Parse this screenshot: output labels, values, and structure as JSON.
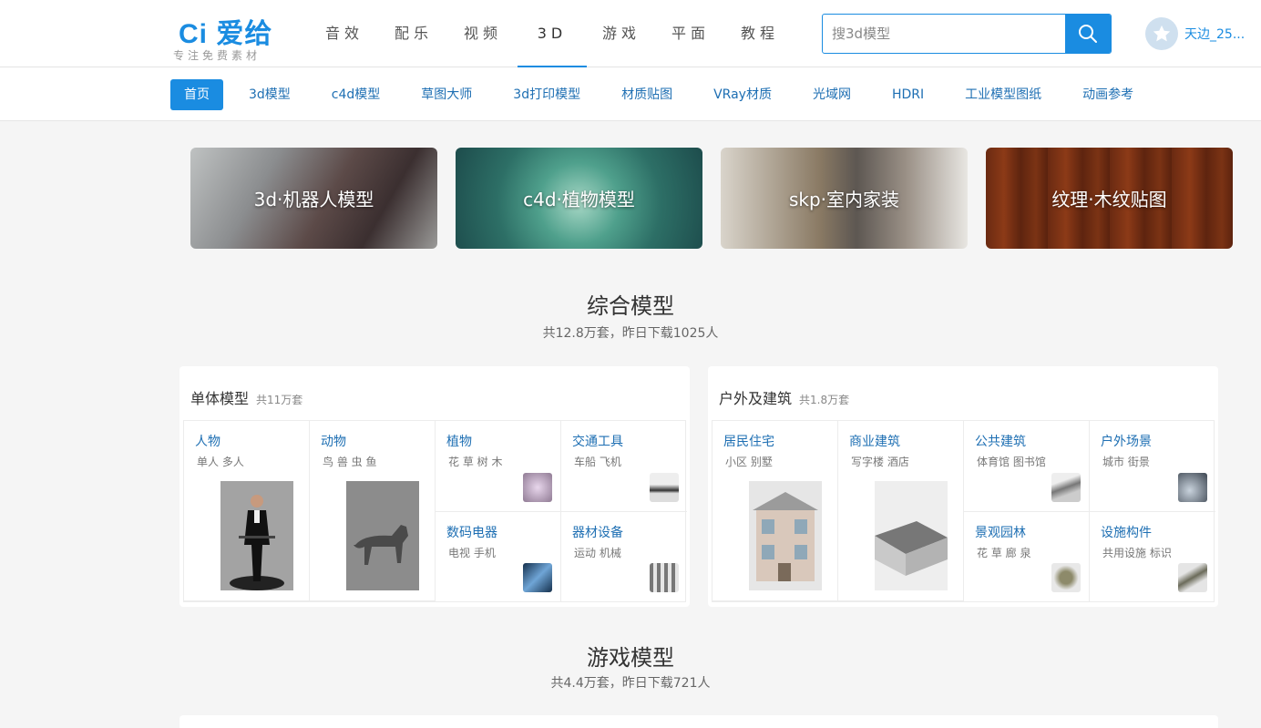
{
  "logo": {
    "brand": "Ci 爱给",
    "tagline": "专注免费素材"
  },
  "main_nav": [
    {
      "label": "音效",
      "active": false
    },
    {
      "label": "配乐",
      "active": false
    },
    {
      "label": "视频",
      "active": false
    },
    {
      "label": "3D",
      "active": true
    },
    {
      "label": "游戏",
      "active": false
    },
    {
      "label": "平面",
      "active": false
    },
    {
      "label": "教程",
      "active": false
    }
  ],
  "search": {
    "placeholder": "搜3d模型",
    "button_icon": "search-icon"
  },
  "user": {
    "name": "天边_25...",
    "avatar_icon": "star-icon"
  },
  "sub_nav": [
    {
      "label": "首页",
      "active": true
    },
    {
      "label": "3d模型"
    },
    {
      "label": "c4d模型"
    },
    {
      "label": "草图大师"
    },
    {
      "label": "3d打印模型"
    },
    {
      "label": "材质贴图"
    },
    {
      "label": "VRay材质"
    },
    {
      "label": "光域网"
    },
    {
      "label": "HDRI"
    },
    {
      "label": "工业模型图纸"
    },
    {
      "label": "动画参考"
    }
  ],
  "banners": [
    {
      "label": "3d·机器人模型"
    },
    {
      "label": "c4d·植物模型"
    },
    {
      "label": "skp·室内家装"
    },
    {
      "label": "纹理·木纹贴图"
    }
  ],
  "sections": [
    {
      "title": "综合模型",
      "subtitle": "共12.8万套，昨日下载1025人"
    },
    {
      "title": "游戏模型",
      "subtitle": "共4.4万套，昨日下载721人"
    }
  ],
  "panels": [
    {
      "name": "单体模型",
      "count": "共11万套",
      "cells": [
        {
          "name": "人物",
          "tags": "单人 多人"
        },
        {
          "name": "动物",
          "tags": "鸟 兽 虫 鱼"
        },
        {
          "name": "植物",
          "tags": "花 草 树 木"
        },
        {
          "name": "交通工具",
          "tags": "车船 飞机"
        },
        {
          "name": "数码电器",
          "tags": "电视 手机"
        },
        {
          "name": "器材设备",
          "tags": "运动 机械"
        }
      ]
    },
    {
      "name": "户外及建筑",
      "count": "共1.8万套",
      "cells": [
        {
          "name": "居民住宅",
          "tags": "小区 别墅"
        },
        {
          "name": "商业建筑",
          "tags": "写字楼 酒店"
        },
        {
          "name": "公共建筑",
          "tags": "体育馆 图书馆"
        },
        {
          "name": "户外场景",
          "tags": "城市 街景"
        },
        {
          "name": "景观园林",
          "tags": "花 草 廊 泉"
        },
        {
          "name": "设施构件",
          "tags": "共用设施 标识"
        }
      ]
    }
  ],
  "colors": {
    "accent": "#1a8ce1",
    "link": "#1e6fb3",
    "background": "#f5f5f5"
  }
}
